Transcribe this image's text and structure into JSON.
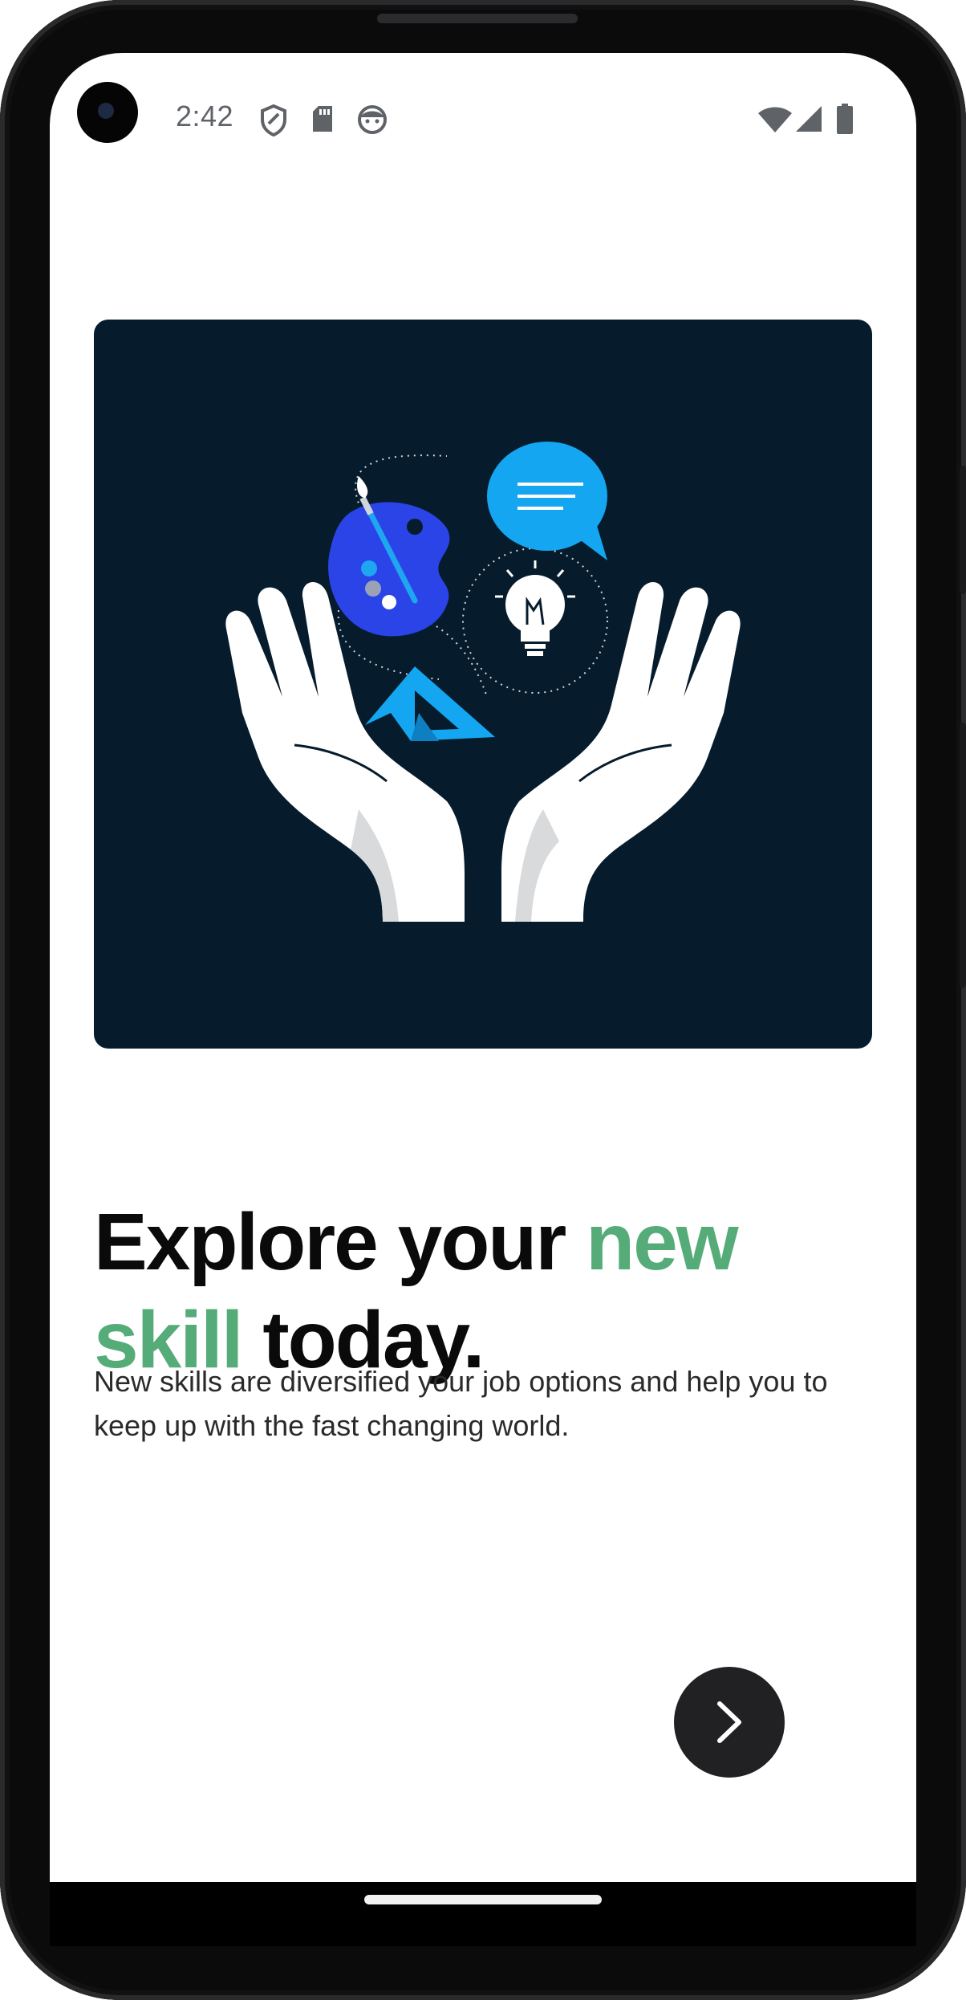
{
  "status_bar": {
    "time": "2:42",
    "left_icons": [
      "shield-icon",
      "sd-card-icon",
      "face-icon"
    ],
    "right_icons": [
      "wifi-icon",
      "signal-icon",
      "battery-icon"
    ]
  },
  "hero": {
    "background_color": "#061c2d",
    "illustration_icons": [
      "hands-icon",
      "paint-palette-icon",
      "paintbrush-icon",
      "chat-bubble-icon",
      "lightbulb-icon",
      "triangle-icon"
    ]
  },
  "headline": {
    "part1": "Explore your ",
    "accent1": "new",
    "accent2": "skill",
    "part2": " today.",
    "accent_color": "#55ac78"
  },
  "subtext": "New skills are diversified your job options and help you to keep up with the fast changing world.",
  "next_button": {
    "icon": "chevron-right-icon"
  }
}
